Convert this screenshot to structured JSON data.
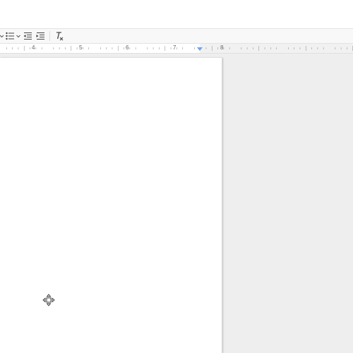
{
  "toolbar": {
    "buttons": [
      {
        "name": "bulleted-list",
        "icon": "bulleted-list-icon"
      },
      {
        "name": "bulleted-list-options",
        "icon": "chevron-down-icon"
      },
      {
        "name": "decrease-indent",
        "icon": "decrease-indent-icon"
      },
      {
        "name": "increase-indent",
        "icon": "increase-indent-icon"
      },
      {
        "name": "clear-formatting",
        "icon": "clear-formatting-icon"
      }
    ]
  },
  "ruler": {
    "labels": [
      "4",
      "5",
      "6",
      "7",
      "8"
    ],
    "indent_marker_color": "#6ea1f0"
  },
  "canvas": {
    "background": "#eeeeee",
    "page_background": "#ffffff"
  }
}
